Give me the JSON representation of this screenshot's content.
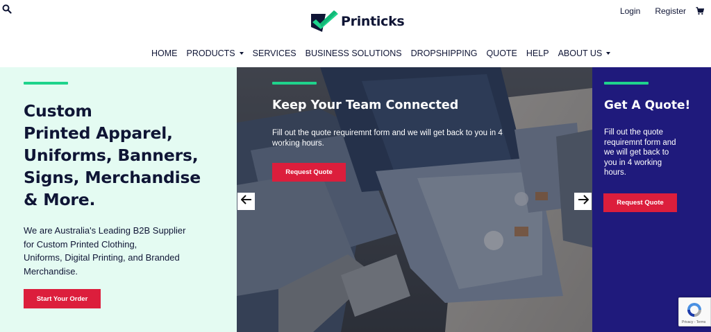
{
  "header": {
    "logo_text": "Printicks",
    "login_label": "Login",
    "register_label": "Register",
    "icons": {
      "search": "search-icon",
      "cart": "cart-icon"
    }
  },
  "nav": {
    "items": [
      {
        "label": "HOME",
        "dropdown": false
      },
      {
        "label": "PRODUCTS",
        "dropdown": true
      },
      {
        "label": "SERVICES",
        "dropdown": false
      },
      {
        "label": "BUSINESS SOLUTIONS",
        "dropdown": false
      },
      {
        "label": "DROPSHIPPING",
        "dropdown": false
      },
      {
        "label": "QUOTE",
        "dropdown": false
      },
      {
        "label": "HELP",
        "dropdown": false
      },
      {
        "label": "ABOUT US",
        "dropdown": true
      }
    ]
  },
  "hero": {
    "title_lines": [
      "Custom",
      "Printed Apparel,",
      "Uniforms, Banners,",
      "Signs, Merchandise",
      "& More."
    ],
    "description_lines": [
      "We are Australia's Leading B2B Supplier",
      "for Custom Printed Clothing,",
      "Uniforms, Digital Printing, and Branded",
      "Merchandise."
    ],
    "cta_label": "Start Your Order"
  },
  "slider": {
    "title": "Keep Your Team Connected",
    "description_lines": [
      "Fill out the quote requiremnt form and we will get back to you in 4",
      "working hours."
    ],
    "cta_label": "Request Quote",
    "prev_icon": "arrow-left-icon",
    "next_icon": "arrow-right-icon"
  },
  "quote_panel": {
    "title": "Get A Quote!",
    "description_lines": [
      "Fill out the quote",
      "requiremnt form and",
      "we will get back to",
      "you in 4 working",
      "hours."
    ],
    "cta_label": "Request Quote"
  },
  "recaptcha": {
    "footer_text": "Privacy - Terms"
  },
  "colors": {
    "brand_navy": "#0f1535",
    "brand_green": "#1fd38c",
    "cta_red": "#dc1e3c",
    "hero_mint": "#e4fbf2",
    "quote_indigo": "#1f1a7c"
  }
}
